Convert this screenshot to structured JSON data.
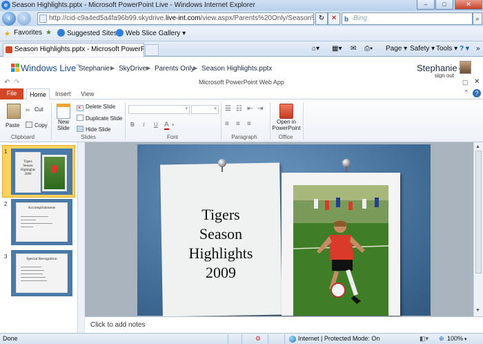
{
  "window": {
    "title": "Season Highlights.pptx - Microsoft PowerPoint Live - Windows Internet Explorer",
    "minimize": "–",
    "maximize": "□",
    "close": "✕"
  },
  "browser": {
    "address_prefix": "http://cid-c9a4ed5a4fa96b99.skydrive.",
    "address_host": "live-int.com",
    "address_suffix": "/view.aspx/Parents%20Only/Season%20Highlights.p",
    "search_placeholder": "Bing",
    "search_logo": "b",
    "favorites_label": "Favorites",
    "suggested_sites": "Suggested Sites",
    "web_slice_gallery": "Web Slice Gallery",
    "tab_title": "Season Highlights.pptx - Microsoft PowerPoint Li...",
    "commands": {
      "page": "Page",
      "safety": "Safety",
      "tools": "Tools",
      "help": "?"
    }
  },
  "live": {
    "brand": "Windows Live",
    "brand_tm": "™",
    "breadcrumb": [
      "Stephanie",
      "SkyDrive",
      "Parents Only",
      "Season Highlights.pptx"
    ],
    "user_name": "Stephanie",
    "sign_out": "sign out"
  },
  "app": {
    "title": "Microsoft PowerPoint Web App"
  },
  "ribbon": {
    "tabs": [
      "File",
      "Home",
      "Insert",
      "View"
    ],
    "clipboard": {
      "paste": "Paste",
      "cut": "Cut",
      "copy": "Copy",
      "group": "Clipboard"
    },
    "slides": {
      "new_slide_1": "New",
      "new_slide_2": "Slide",
      "delete": "Delete Slide",
      "duplicate": "Duplicate Slide",
      "hide": "Hide Slide",
      "group": "Slides"
    },
    "font": {
      "bold": "B",
      "italic": "I",
      "underline": "U",
      "color": "A",
      "group": "Font"
    },
    "paragraph": {
      "group": "Paragraph"
    },
    "office": {
      "open_1": "Open in",
      "open_2": "PowerPoint",
      "group": "Office"
    }
  },
  "thumbnails": [
    {
      "num": "1",
      "title_lines": [
        "Tigers",
        "Season",
        "Highlights",
        "2009"
      ]
    },
    {
      "num": "2",
      "title": "Accomplishments"
    },
    {
      "num": "3",
      "title": "Special Recognition"
    }
  ],
  "slide": {
    "title_lines": [
      "Tigers",
      "Season",
      "Highlights",
      "2009"
    ]
  },
  "notes": {
    "placeholder": "Click to add notes"
  },
  "status": {
    "done": "Done",
    "zone": "Internet | Protected Mode: On",
    "zoom": "100%"
  }
}
